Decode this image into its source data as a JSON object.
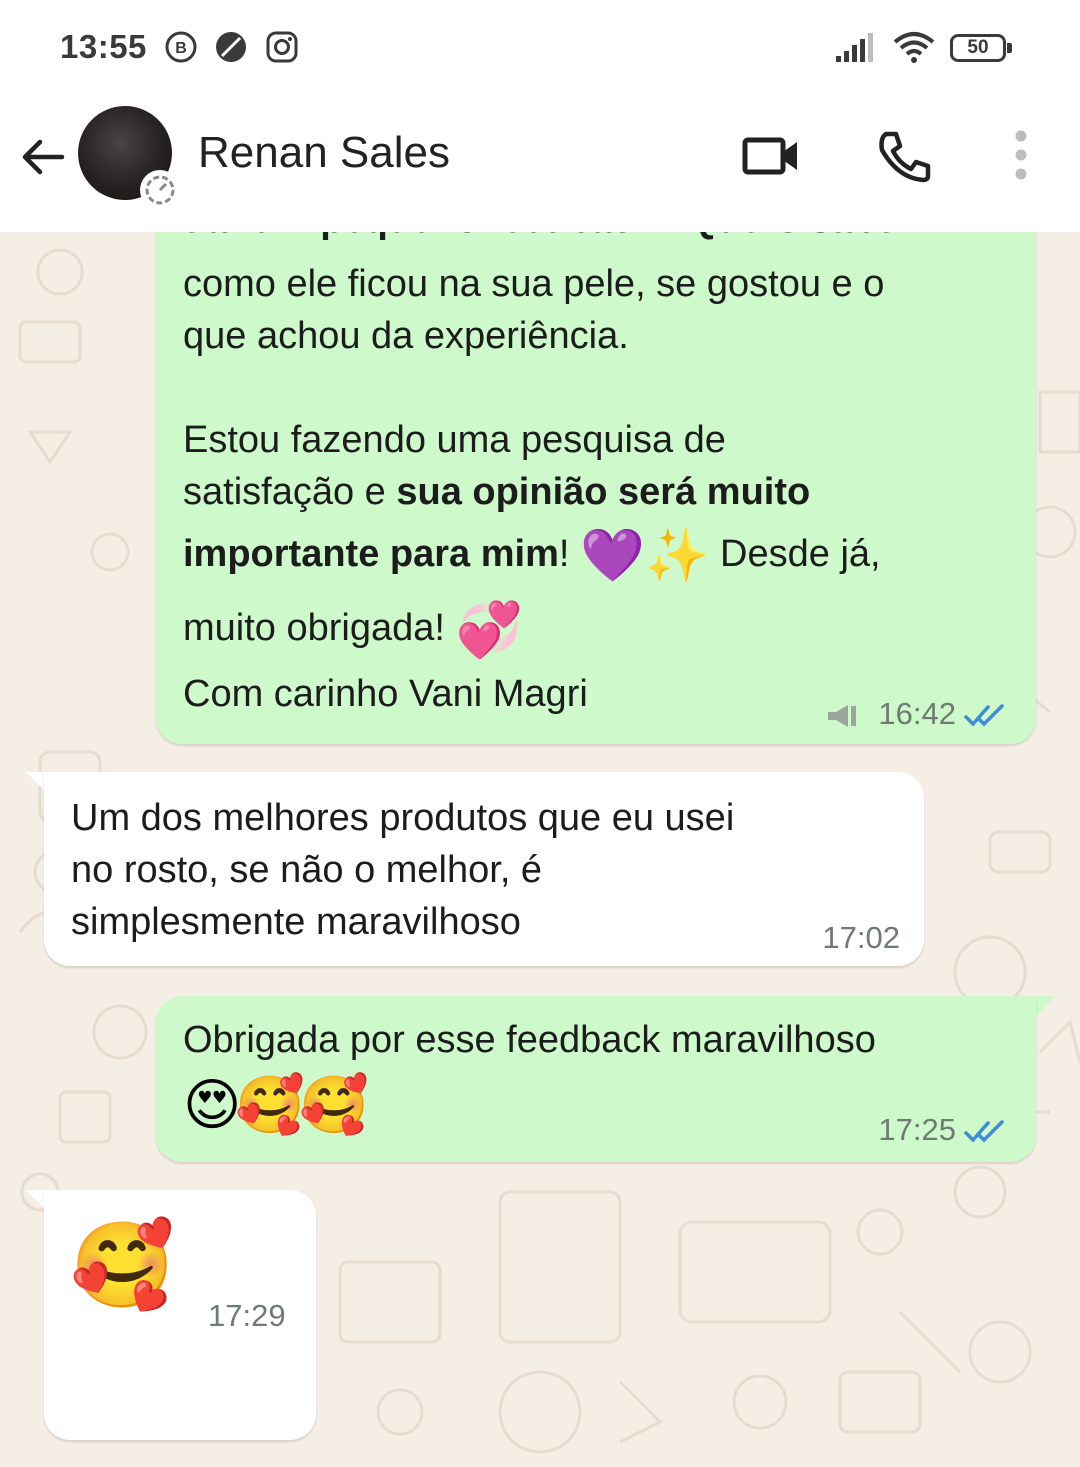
{
  "status_bar": {
    "time": "13:55",
    "battery_level": "50",
    "icons": [
      "b-badge-icon",
      "moon-icon",
      "instagram-icon",
      "signal-icon",
      "wifi-icon",
      "battery-icon"
    ]
  },
  "header": {
    "contact_name": "Renan Sales",
    "icons": [
      "back-arrow-icon",
      "video-call-icon",
      "phone-icon",
      "more-vert-icon"
    ]
  },
  "messages": [
    {
      "direction": "outgoing",
      "cut_line": "dar um pequeno feedback? Quero saber",
      "para1": "como ele ficou na sua pele, se gostou e o\nque achou da experiência.",
      "para2_plain": "Estou fazendo uma pesquisa de\nsatisfação e ",
      "para2_bold": "sua opinião será muito",
      "para3_bold": "importante para mim",
      "para3_plain": "! ",
      "para3_emojis": "💜✨",
      "para3_tail": " Desde já,",
      "para4": "muito obrigada! ",
      "para4_emoji": "💞",
      "para5": "Com carinho Vani Magri",
      "time": "16:42",
      "status": "read"
    },
    {
      "direction": "incoming",
      "text": "Um dos melhores produtos que eu usei\nno rosto, se não o melhor, é\nsimplesmente maravilhoso",
      "time": "17:02"
    },
    {
      "direction": "outgoing",
      "text": "Obrigada por esse feedback maravilhoso",
      "emojis": "😍🥰🥰",
      "time": "17:25",
      "status": "read"
    },
    {
      "direction": "incoming",
      "emoji": "🥰",
      "time": "17:29"
    }
  ],
  "colors": {
    "outgoing_bubble": "#cdf9cb",
    "incoming_bubble": "#ffffff",
    "chat_background": "#f5eee5",
    "read_ticks": "#3d8bd9"
  }
}
